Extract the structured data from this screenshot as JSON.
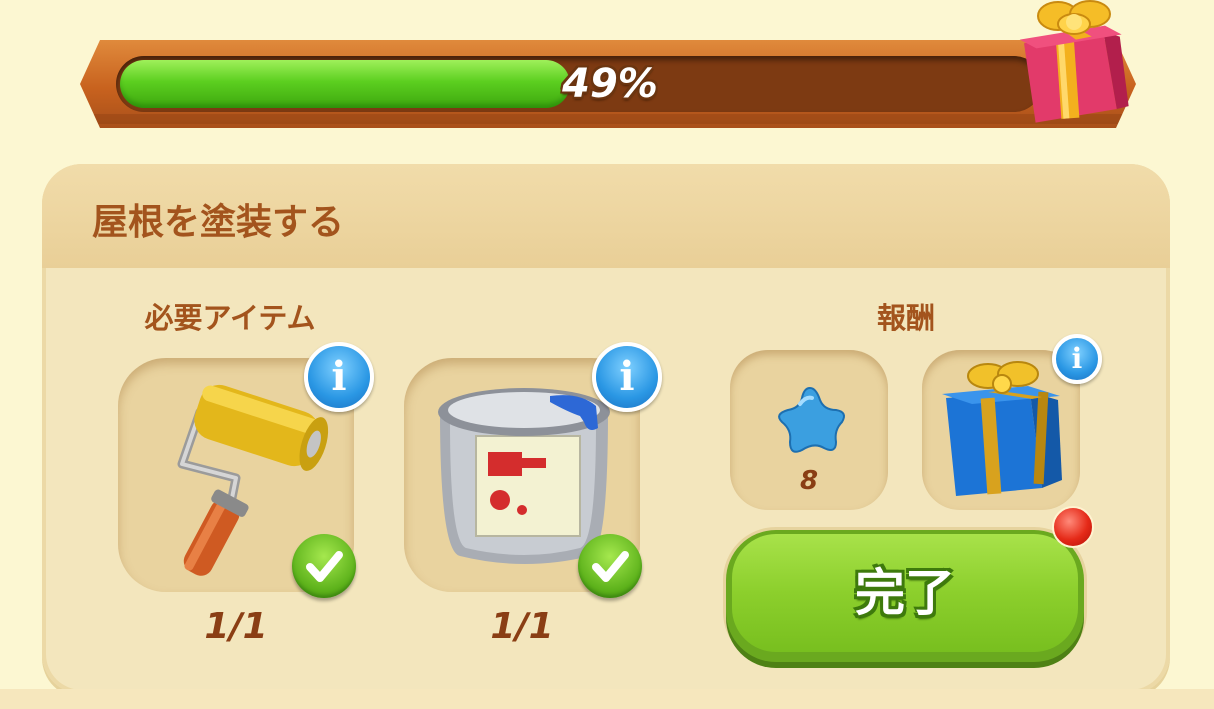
{
  "progress": {
    "percent_label": "49%",
    "fraction": 0.49
  },
  "task": {
    "title": "屋根を塗装する",
    "required_label": "必要アイテム",
    "reward_label": "報酬",
    "complete_label": "完了"
  },
  "required_items": [
    {
      "name": "paint-roller",
      "count": "1/1",
      "completed": true
    },
    {
      "name": "paint-can",
      "count": "1/1",
      "completed": true
    }
  ],
  "rewards": [
    {
      "name": "blue-star",
      "count": "8"
    },
    {
      "name": "blue-gift-box",
      "count": ""
    }
  ],
  "colors": {
    "label_brown": "#a3541d",
    "progress_green": "#5ccf20",
    "button_green": "#8ccf2c",
    "info_blue": "#2a97e4"
  }
}
